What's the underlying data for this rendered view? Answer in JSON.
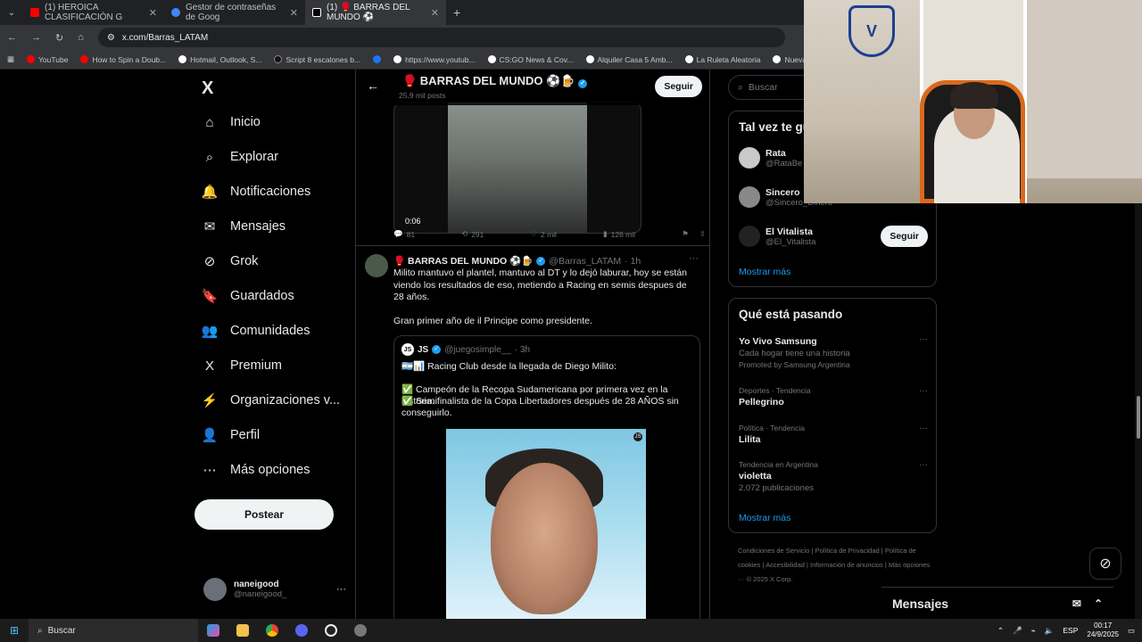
{
  "browser": {
    "tabs": [
      {
        "label": "(1) HEROICA CLASIFICACIÓN G",
        "color": "#ff0000"
      },
      {
        "label": "Gestor de contraseñas de Goog",
        "color": "#4285f4"
      },
      {
        "label": "(1) 🥊 BARRAS DEL MUNDO ⚽",
        "color": "#ffffff"
      }
    ],
    "url": "x.com/Barras_LATAM",
    "bookmarks": [
      {
        "label": "YouTube",
        "color": "#ff0000"
      },
      {
        "label": "How to Spin a Doub...",
        "color": "#ff0000"
      },
      {
        "label": "Hotmail, Outlook, S...",
        "color": "#ffffff"
      },
      {
        "label": "Script 8 escalones b...",
        "color": "#111111"
      },
      {
        "label": "",
        "color": "#1877f2"
      },
      {
        "label": "https://www.youtub...",
        "color": "#ffffff"
      },
      {
        "label": "CS:GO News & Cov...",
        "color": "#ffffff"
      },
      {
        "label": "Alquiler Casa 5 Amb...",
        "color": "#ffffff"
      },
      {
        "label": "La Ruleta Aleatoria",
        "color": "#ffffff"
      },
      {
        "label": "Nueva pe",
        "color": "#ffffff"
      }
    ]
  },
  "nav": {
    "logo": "X",
    "items": [
      {
        "label": "Inicio",
        "icon": "⌂"
      },
      {
        "label": "Explorar",
        "icon": "⌕"
      },
      {
        "label": "Notificaciones",
        "icon": "🔔"
      },
      {
        "label": "Mensajes",
        "icon": "✉"
      },
      {
        "label": "Grok",
        "icon": "⊘"
      },
      {
        "label": "Guardados",
        "icon": "🔖"
      },
      {
        "label": "Comunidades",
        "icon": "👥"
      },
      {
        "label": "Premium",
        "icon": "X"
      },
      {
        "label": "Organizaciones v...",
        "icon": "⚡"
      },
      {
        "label": "Perfil",
        "icon": "👤"
      },
      {
        "label": "Más opciones",
        "icon": "⋯"
      }
    ],
    "post_label": "Postear",
    "user": {
      "name": "naneigood",
      "handle": "@naneigood_"
    }
  },
  "profile_header": {
    "title": "🥊 BARRAS DEL MUNDO ⚽🍺",
    "posts": "25,9 mil posts",
    "follow_label": "Seguir"
  },
  "video_post": {
    "duration": "0:06",
    "replies": "81",
    "reposts": "291",
    "likes": "2 mil",
    "views": "126 mil"
  },
  "tweet": {
    "name": "🥊 BARRAS DEL MUNDO ⚽🍺",
    "handle": "@Barras_LATAM",
    "time": "· 1h",
    "text": "Milito mantuvo el plantel, mantuvo al DT y lo dejó laburar, hoy se están viendo los resultados de eso, metiendo a Racing en semis despues de 28 años.",
    "text2": "Gran primer año de il Principe como presidente.",
    "quote": {
      "avatar": "JS",
      "name": "JS",
      "handle": "@juegosimple__",
      "time": "· 3h",
      "line1": "🇦🇷📊 Racing Club desde la llegada de Diego Milito:",
      "line2": "✅ Campeón de la Recopa Sudamericana por primera vez en la historia.",
      "line3": "✅ Semifinalista de la Copa Libertadores después de 28 AÑOS sin conseguirlo.",
      "badge": "JS"
    }
  },
  "right": {
    "search_placeholder": "Buscar",
    "who_title": "Tal vez te gu",
    "suggestions": [
      {
        "name": "Rata",
        "handle": "@RataBe",
        "follow": ""
      },
      {
        "name": "Sincero",
        "handle": "@Sincero_Dinero",
        "follow": ""
      },
      {
        "name": "El Vitalista",
        "handle": "@El_Vitalista",
        "follow": "Seguir"
      }
    ],
    "show_more": "Mostrar más",
    "trends_title": "Qué está pasando",
    "trends": [
      {
        "ctx": "",
        "title": "Yo Vivo Samsung",
        "sub": "Cada hogar tiene una historia",
        "sub2": "Promoted by Samsung Argentina"
      },
      {
        "ctx": "Deportes · Tendencia",
        "title": "Pellegrino",
        "sub": "",
        "sub2": ""
      },
      {
        "ctx": "Política · Tendencia",
        "title": "Lilita",
        "sub": "",
        "sub2": ""
      },
      {
        "ctx": "Tendencia en Argentina",
        "title": "violetta",
        "sub": "2.072 publicaciones",
        "sub2": ""
      }
    ],
    "show_more2": "Mostrar más",
    "footer": "Condiciones de Servicio | Política de Privacidad | Política de cookies | Accesibilidad | Información de anuncios | Más opciones ··· © 2025 X Corp."
  },
  "messages_bar": {
    "label": "Mensajes"
  },
  "taskbar": {
    "search": "Buscar",
    "lang": "ESP",
    "time": "00:17",
    "date": "24/9/2025"
  }
}
